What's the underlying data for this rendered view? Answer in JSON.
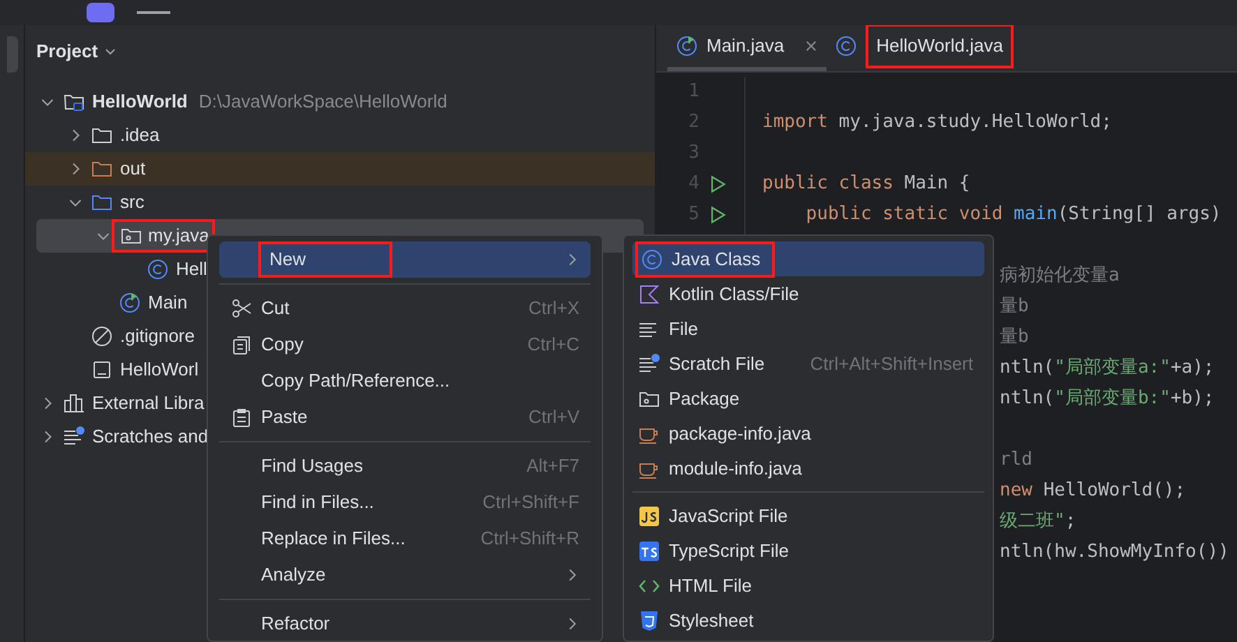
{
  "project_panel": {
    "title": "Project",
    "tree": [
      {
        "label": "HelloWorld",
        "detail": "D:\\JavaWorkSpace\\HelloWorld",
        "kind": "module",
        "expanded": true,
        "children": [
          {
            "label": ".idea",
            "kind": "folder",
            "expanded": false
          },
          {
            "label": "out",
            "kind": "folder-excluded",
            "expanded": false,
            "highlighted": true
          },
          {
            "label": "src",
            "kind": "folder-source",
            "expanded": true,
            "children": [
              {
                "label": "my.java",
                "kind": "package",
                "expanded": true,
                "selected": true,
                "marked": true,
                "children": [
                  {
                    "label": "Hell",
                    "kind": "class"
                  }
                ]
              },
              {
                "label": "Main",
                "kind": "main-class"
              }
            ]
          },
          {
            "label": ".gitignore",
            "kind": "ignore"
          },
          {
            "label": "HelloWorl",
            "kind": "file"
          }
        ]
      },
      {
        "label": "External Libra",
        "kind": "library",
        "expanded": false
      },
      {
        "label": "Scratches and",
        "kind": "scratches",
        "expanded": false
      }
    ]
  },
  "editor": {
    "tabs": [
      {
        "label": "Main.java",
        "kind": "main-class",
        "selected": true,
        "closable": true,
        "marked": false
      },
      {
        "label": "HelloWorld.java",
        "kind": "class",
        "selected": false,
        "closable": false,
        "marked": true
      }
    ],
    "lines": [
      {
        "kind": "full",
        "number": "1"
      },
      {
        "kind": "full",
        "number": "2",
        "tokens": [
          {
            "text": "import ",
            "kind": "keyword"
          },
          {
            "text": "my.java.study.HelloWorld;",
            "kind": "plain"
          }
        ]
      },
      {
        "kind": "full",
        "number": "3"
      },
      {
        "kind": "full",
        "number": "4",
        "run": true,
        "tokens": [
          {
            "text": "public class ",
            "kind": "keyword"
          },
          {
            "text": "Main {",
            "kind": "plain"
          }
        ]
      },
      {
        "kind": "full",
        "number": "5",
        "run": true,
        "tokens": [
          {
            "text": "    public static void ",
            "kind": "keyword"
          },
          {
            "text": "main",
            "kind": "method"
          },
          {
            "text": "(String[] args)",
            "kind": "plain"
          }
        ]
      },
      {
        "kind": "blank"
      },
      {
        "kind": "partial",
        "tokens": [
          {
            "text": "病初始化变量a",
            "kind": "comment"
          }
        ]
      },
      {
        "kind": "partial",
        "tokens": [
          {
            "text": "量b",
            "kind": "comment"
          }
        ]
      },
      {
        "kind": "partial",
        "tokens": [
          {
            "text": "量b",
            "kind": "comment"
          }
        ]
      },
      {
        "kind": "partial",
        "tokens": [
          {
            "text": "ntln(",
            "kind": "plain"
          },
          {
            "text": "\"局部变量a:\"",
            "kind": "string"
          },
          {
            "text": "+a);",
            "kind": "plain"
          }
        ]
      },
      {
        "kind": "partial",
        "tokens": [
          {
            "text": "ntln(",
            "kind": "plain"
          },
          {
            "text": "\"局部变量b:\"",
            "kind": "string"
          },
          {
            "text": "+b);",
            "kind": "plain"
          }
        ]
      },
      {
        "kind": "blank"
      },
      {
        "kind": "partial",
        "tokens": [
          {
            "text": "rld",
            "kind": "comment"
          }
        ]
      },
      {
        "kind": "partial",
        "tokens": [
          {
            "text": "new ",
            "kind": "keyword"
          },
          {
            "text": "HelloWorld();",
            "kind": "plain"
          }
        ]
      },
      {
        "kind": "partial",
        "tokens": [
          {
            "text": "级二班\"",
            "kind": "string"
          },
          {
            "text": ";",
            "kind": "plain"
          }
        ]
      },
      {
        "kind": "partial",
        "tokens": [
          {
            "text": "ntln(hw.ShowMyInfo())",
            "kind": "plain"
          }
        ]
      }
    ]
  },
  "context_menu": {
    "items": [
      {
        "kind": "plain",
        "label": "New",
        "submenu": true,
        "selected": true,
        "marked": true
      },
      {
        "kind": "separator"
      },
      {
        "kind": "cut",
        "label": "Cut",
        "shortcut": "Ctrl+X",
        "selected": false
      },
      {
        "kind": "copy",
        "label": "Copy",
        "shortcut": "Ctrl+C",
        "selected": false
      },
      {
        "kind": "plain",
        "label": "Copy Path/Reference...",
        "selected": false
      },
      {
        "kind": "paste",
        "label": "Paste",
        "shortcut": "Ctrl+V",
        "selected": false
      },
      {
        "kind": "separator"
      },
      {
        "kind": "plain",
        "label": "Find Usages",
        "shortcut": "Alt+F7",
        "selected": false
      },
      {
        "kind": "plain",
        "label": "Find in Files...",
        "shortcut": "Ctrl+Shift+F",
        "selected": false
      },
      {
        "kind": "plain",
        "label": "Replace in Files...",
        "shortcut": "Ctrl+Shift+R",
        "selected": false
      },
      {
        "kind": "plain",
        "label": "Analyze",
        "submenu": true,
        "selected": false
      },
      {
        "kind": "separator"
      },
      {
        "kind": "plain",
        "label": "Refactor",
        "submenu": true,
        "selected": false
      }
    ]
  },
  "new_submenu": {
    "items": [
      {
        "kind": "class",
        "label": "Java Class",
        "selected": true,
        "marked": true
      },
      {
        "kind": "kotlin",
        "label": "Kotlin Class/File",
        "selected": false
      },
      {
        "kind": "file-lines",
        "label": "File",
        "selected": false
      },
      {
        "kind": "scratches",
        "label": "Scratch File",
        "shortcut": "Ctrl+Alt+Shift+Insert",
        "selected": false
      },
      {
        "kind": "package",
        "label": "Package",
        "selected": false
      },
      {
        "kind": "cup",
        "label": "package-info.java",
        "selected": false
      },
      {
        "kind": "cup",
        "label": "module-info.java",
        "selected": false
      },
      {
        "kind": "separator"
      },
      {
        "kind": "js",
        "label": "JavaScript File",
        "selected": false
      },
      {
        "kind": "ts",
        "label": "TypeScript File",
        "selected": false
      },
      {
        "kind": "html",
        "label": "HTML File",
        "selected": false
      },
      {
        "kind": "css",
        "label": "Stylesheet",
        "selected": false
      }
    ]
  }
}
